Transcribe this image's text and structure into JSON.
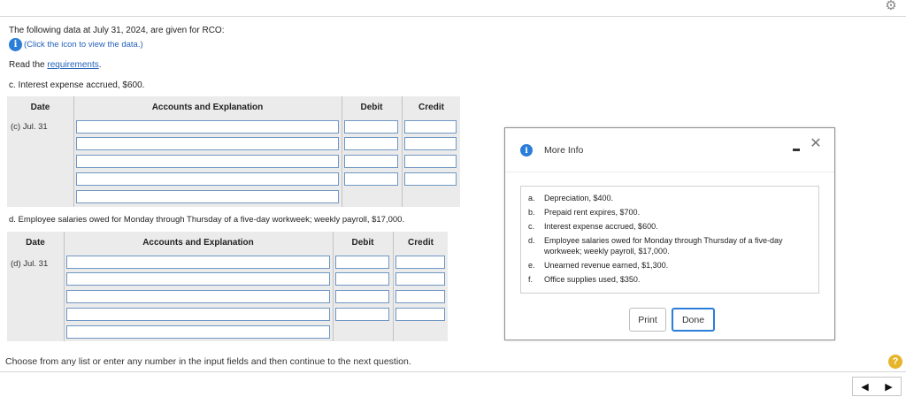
{
  "header": {
    "settings_icon": "gear-icon"
  },
  "intro": {
    "line1": "The following data at July 31, 2024, are given for RCO:",
    "info_text": "(Click the icon to view the data.)",
    "read_prefix": "Read the ",
    "read_link": "requirements",
    "read_suffix": "."
  },
  "section_c": {
    "title": "c. Interest expense accrued, $600.",
    "columns": {
      "date": "Date",
      "account": "Accounts and Explanation",
      "debit": "Debit",
      "credit": "Credit"
    },
    "date_label": "(c) Jul. 31"
  },
  "section_d": {
    "title": "d. Employee salaries owed for Monday through Thursday of a five-day workweek; weekly payroll, $17,000.",
    "columns": {
      "date": "Date",
      "account": "Accounts and Explanation",
      "debit": "Debit",
      "credit": "Credit"
    },
    "date_label": "(d) Jul. 31"
  },
  "footer": {
    "instruction": "Choose from any list or enter any number in the input fields and then continue to the next question.",
    "help": "?"
  },
  "modal": {
    "title": "More Info",
    "items": [
      {
        "letter": "a.",
        "text": "Depreciation, $400."
      },
      {
        "letter": "b.",
        "text": "Prepaid rent expires, $700."
      },
      {
        "letter": "c.",
        "text": "Interest expense accrued, $600."
      },
      {
        "letter": "d.",
        "text": "Employee salaries owed for Monday through Thursday of a five-day workweek; weekly payroll, $17,000."
      },
      {
        "letter": "e.",
        "text": "Unearned revenue earned, $1,300."
      },
      {
        "letter": "f.",
        "text": "Office supplies used, $350."
      }
    ],
    "print_label": "Print",
    "done_label": "Done"
  },
  "colors": {
    "accent": "#2a7dd8",
    "link": "#2462b9",
    "help": "#e6b52c"
  }
}
